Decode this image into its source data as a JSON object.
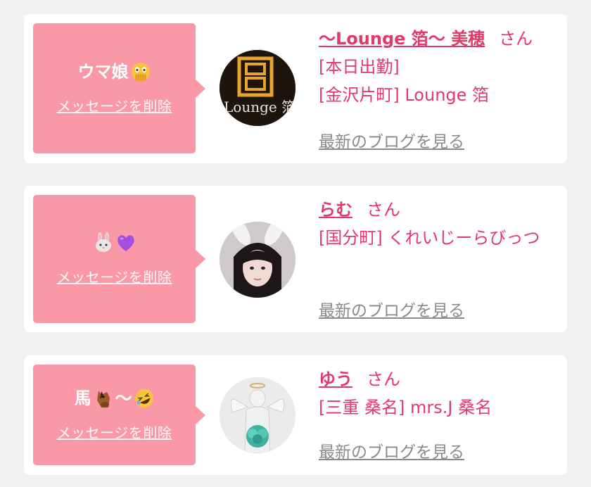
{
  "cards": [
    {
      "message": "ウマ娘",
      "message_emoji": "face-with-open-eyes-and-hand-over-mouth",
      "delete_label": "メッセージを削除",
      "name": "〜Lounge 箔〜 美穂",
      "honorific": "さん",
      "lines": [
        "[本日出勤]",
        "[金沢片町] Lounge 箔"
      ],
      "blog_label": "最新のブログを見る",
      "avatar_text": "Lounge 箔",
      "avatar_logo": "ロ"
    },
    {
      "message_emojis": [
        "rabbit-face",
        "purple-heart"
      ],
      "delete_label": "メッセージを削除",
      "name": "らむ",
      "honorific": "さん",
      "lines": [
        "[国分町] くれいじーらびっつ"
      ],
      "blog_label": "最新のブログを見る"
    },
    {
      "message": "馬",
      "message_tail": "〜",
      "message_emojis": [
        "horse-face",
        "rolling-on-the-floor-laughing"
      ],
      "delete_label": "メッセージを削除",
      "name": "ゆう",
      "honorific": "さん",
      "lines": [
        "[三重 桑名] mrs.J 桑名"
      ],
      "blog_label": "最新のブログを見る"
    }
  ],
  "colors": {
    "accent": "#e3386b",
    "message_bg": "#fb98a8",
    "card_bg": "#ffffff",
    "page_bg": "#f1f1f1",
    "link_gray": "#8a8a8a"
  }
}
